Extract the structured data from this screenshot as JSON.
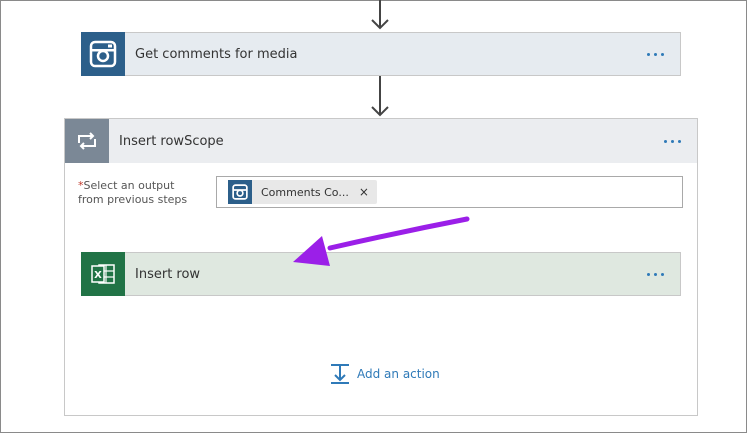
{
  "steps": {
    "instagram": {
      "title": "Get comments for media",
      "icon": "instagram-icon",
      "menu_icon": "ellipsis-icon"
    },
    "scope": {
      "title": "Insert rowScope",
      "icon": "loop-icon",
      "field": {
        "required_mark": "*",
        "label": "Select an output from previous steps",
        "token_label": "Comments Co...",
        "token_close": "×"
      },
      "inner_action": {
        "title": "Insert row",
        "icon": "excel-icon"
      },
      "add_action": {
        "label": "Add an action",
        "icon": "add-action-icon"
      }
    }
  },
  "colors": {
    "accent": "#2f7ab8",
    "instagram": "#2c5f8a",
    "excel": "#217346",
    "scope_icon": "#7b8896",
    "annotation": "#9b1fe8"
  }
}
